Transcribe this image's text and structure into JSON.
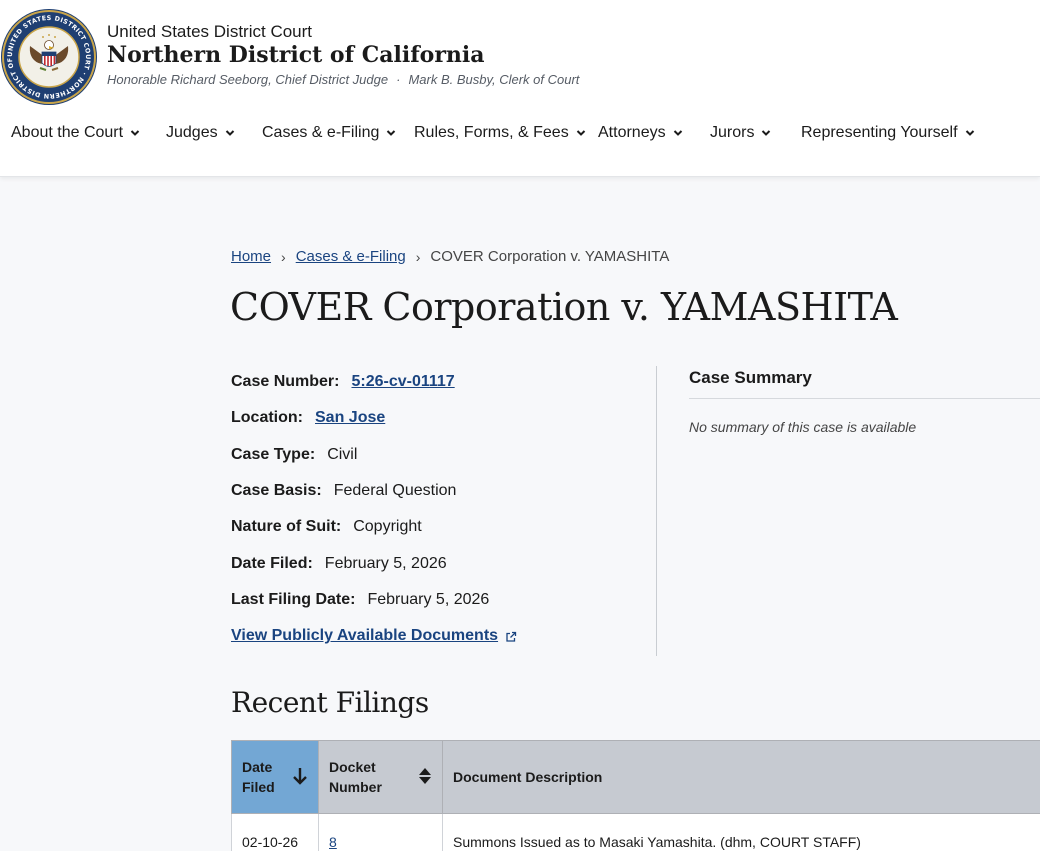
{
  "header": {
    "court_line1": "United States District Court",
    "court_name": "Northern District of California",
    "chief_judge": "Honorable Richard Seeborg, Chief District Judge",
    "separator": "·",
    "clerk": "Mark B. Busby, Clerk of Court",
    "seal_icon": "court-seal-icon",
    "seal_ring_text": "UNITED STATES DISTRICT COURT · NORTHERN DISTRICT OF CALIFORNIA"
  },
  "nav": {
    "items": [
      {
        "label": "About the Court"
      },
      {
        "label": "Judges"
      },
      {
        "label": "Cases & e-Filing"
      },
      {
        "label": "Rules, Forms, & Fees"
      },
      {
        "label": "Attorneys"
      },
      {
        "label": "Jurors"
      },
      {
        "label": "Representing Yourself"
      }
    ],
    "chevron_icon": "chevron-down-icon"
  },
  "breadcrumb": {
    "home": "Home",
    "section": "Cases & e-Filing",
    "current": "COVER Corporation v. YAMASHITA",
    "separator": "›"
  },
  "case": {
    "title": "COVER Corporation v. YAMASHITA",
    "fields": {
      "case_number": {
        "label": "Case Number:",
        "value": "5:26-cv-01117"
      },
      "location": {
        "label": "Location:",
        "value": "San Jose"
      },
      "case_type": {
        "label": "Case Type:",
        "value": "Civil"
      },
      "case_basis": {
        "label": "Case Basis:",
        "value": "Federal Question"
      },
      "nature_of_suit": {
        "label": "Nature of Suit:",
        "value": "Copyright"
      },
      "date_filed": {
        "label": "Date Filed:",
        "value": "February 5, 2026"
      },
      "last_filing_date": {
        "label": "Last Filing Date:",
        "value": "February 5, 2026"
      }
    },
    "documents_link": "View Publicly Available Documents",
    "external_icon": "external-link-icon"
  },
  "summary": {
    "title": "Case Summary",
    "text": "No summary of this case is available"
  },
  "filings": {
    "title": "Recent Filings",
    "columns": {
      "date_filed": {
        "line1": "Date",
        "line2": "Filed",
        "sort_icon": "arrow-down-icon"
      },
      "docket_number": {
        "line1": "Docket",
        "line2": "Number",
        "sort_icon": "sort-icon"
      },
      "description": {
        "label": "Document Description"
      }
    },
    "rows": [
      {
        "date": "02-10-26",
        "docket": "8",
        "description": "Summons Issued as to Masaki Yamashita. (dhm, COURT STAFF)"
      }
    ]
  },
  "colors": {
    "link": "#1a4480",
    "header_active": "#73a7d4",
    "header_default": "#c6cad1"
  }
}
